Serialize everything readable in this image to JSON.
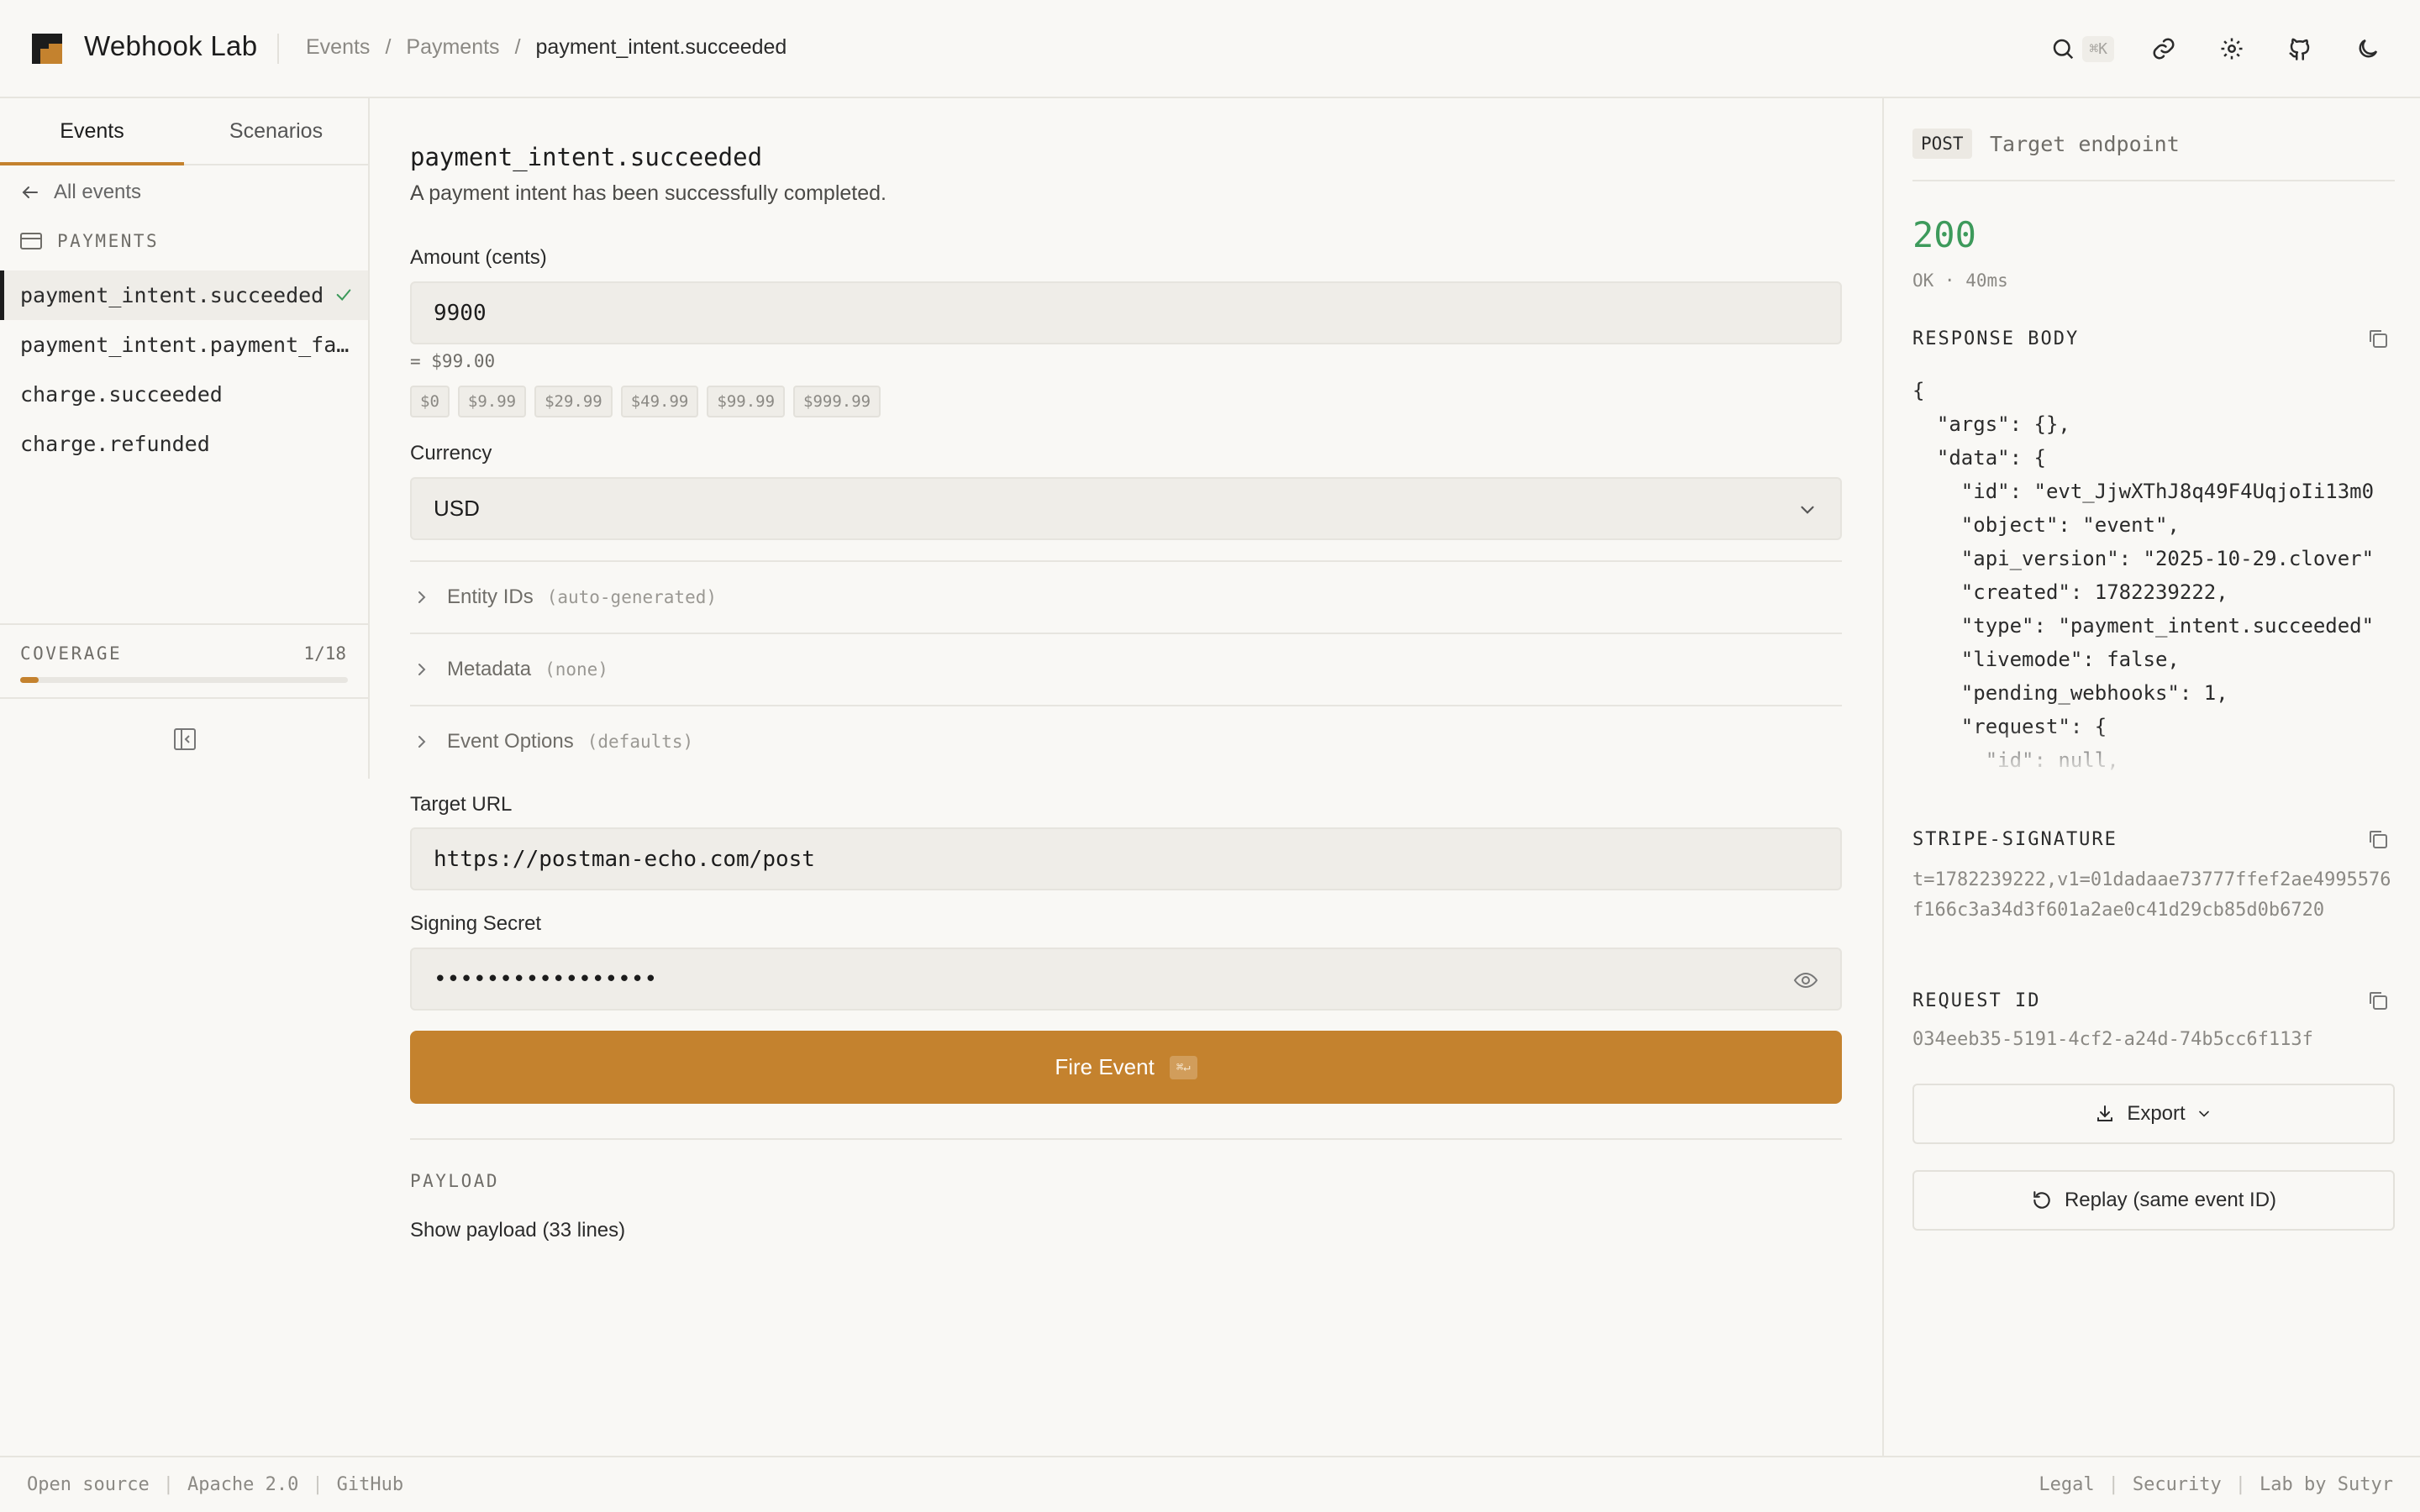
{
  "app": {
    "title": "Webhook Lab"
  },
  "breadcrumb": [
    "Events",
    "Payments",
    "payment_intent.succeeded"
  ],
  "header": {
    "search_shortcut": "⌘K"
  },
  "sidebar": {
    "tabs": [
      {
        "label": "Events"
      },
      {
        "label": "Scenarios"
      }
    ],
    "back_label": "All events",
    "category": "PAYMENTS",
    "events": [
      {
        "label": "payment_intent.succeeded"
      },
      {
        "label": "payment_intent.payment_failed"
      },
      {
        "label": "charge.succeeded"
      },
      {
        "label": "charge.refunded"
      }
    ],
    "coverage": {
      "label": "COVERAGE",
      "count": "1/18",
      "fraction": 0.0556
    }
  },
  "main": {
    "event_name": "payment_intent.succeeded",
    "event_description": "A payment intent has been successfully completed.",
    "amount": {
      "label": "Amount (cents)",
      "value": "9900",
      "hint": "= $99.00"
    },
    "presets": [
      "$0",
      "$9.99",
      "$29.99",
      "$49.99",
      "$99.99",
      "$999.99"
    ],
    "currency": {
      "label": "Currency",
      "value": "USD"
    },
    "sections": [
      {
        "title": "Entity IDs",
        "sub": "(auto-generated)"
      },
      {
        "title": "Metadata",
        "sub": "(none)"
      },
      {
        "title": "Event Options",
        "sub": "(defaults)"
      }
    ],
    "target_url": {
      "label": "Target URL",
      "value": "https://postman-echo.com/post"
    },
    "signing_secret": {
      "label": "Signing Secret",
      "value": "•••••••••••••••••"
    },
    "fire": {
      "label": "Fire Event",
      "shortcut": "⌘↵"
    },
    "payload": {
      "label": "PAYLOAD",
      "toggle": "Show payload (33 lines)"
    }
  },
  "response": {
    "method": "POST",
    "endpoint": "Target endpoint",
    "status_code": "200",
    "status_meta": "OK · 40ms",
    "body_label": "RESPONSE BODY",
    "body_lines": [
      {
        "t": "{",
        "cls": "p"
      },
      {
        "t": "  \"args\": {},",
        "cls": ""
      },
      {
        "t": "  \"data\": {",
        "cls": ""
      },
      {
        "t": "    \"id\": \"evt_JjwXThJ8q49F4UqjoIi13m0",
        "cls": ""
      },
      {
        "t": "    \"object\": \"event\",",
        "cls": ""
      },
      {
        "t": "    \"api_version\": \"2025-10-29.clover\"",
        "cls": ""
      },
      {
        "t": "    \"created\": 1782239222,",
        "cls": ""
      },
      {
        "t": "    \"type\": \"payment_intent.succeeded\"",
        "cls": ""
      },
      {
        "t": "    \"livemode\": false,",
        "cls": ""
      },
      {
        "t": "    \"pending_webhooks\": 1,",
        "cls": ""
      },
      {
        "t": "    \"request\": {",
        "cls": ""
      },
      {
        "t": "      \"id\": null,",
        "cls": ""
      }
    ],
    "signature_label": "STRIPE-SIGNATURE",
    "signature_value": "t=1782239222,v1=01dadaae73777ffef2ae4995576f166c3a34d3f601a2ae0c41d29cb85d0b6720",
    "request_id_label": "REQUEST ID",
    "request_id_value": "034eeb35-5191-4cf2-a24d-74b5cc6f113f",
    "export_label": "Export",
    "replay_label": "Replay (same event ID)"
  },
  "footer": {
    "left": [
      "Open source",
      "Apache 2.0",
      "GitHub"
    ],
    "right": [
      "Legal",
      "Security",
      "Lab by Sutyr"
    ]
  },
  "colors": {
    "accent": "#c4822e",
    "success": "#3d9a5b",
    "background": "#f9f8f5"
  },
  "icons": [
    "logo-icon",
    "search-icon",
    "link-icon",
    "gear-icon",
    "github-icon",
    "moon-icon",
    "arrow-left-icon",
    "card-icon",
    "check-icon",
    "sidebar-collapse-icon",
    "chevron-down-icon",
    "chevron-right-icon",
    "eye-icon",
    "copy-icon",
    "download-icon",
    "refresh-icon"
  ]
}
